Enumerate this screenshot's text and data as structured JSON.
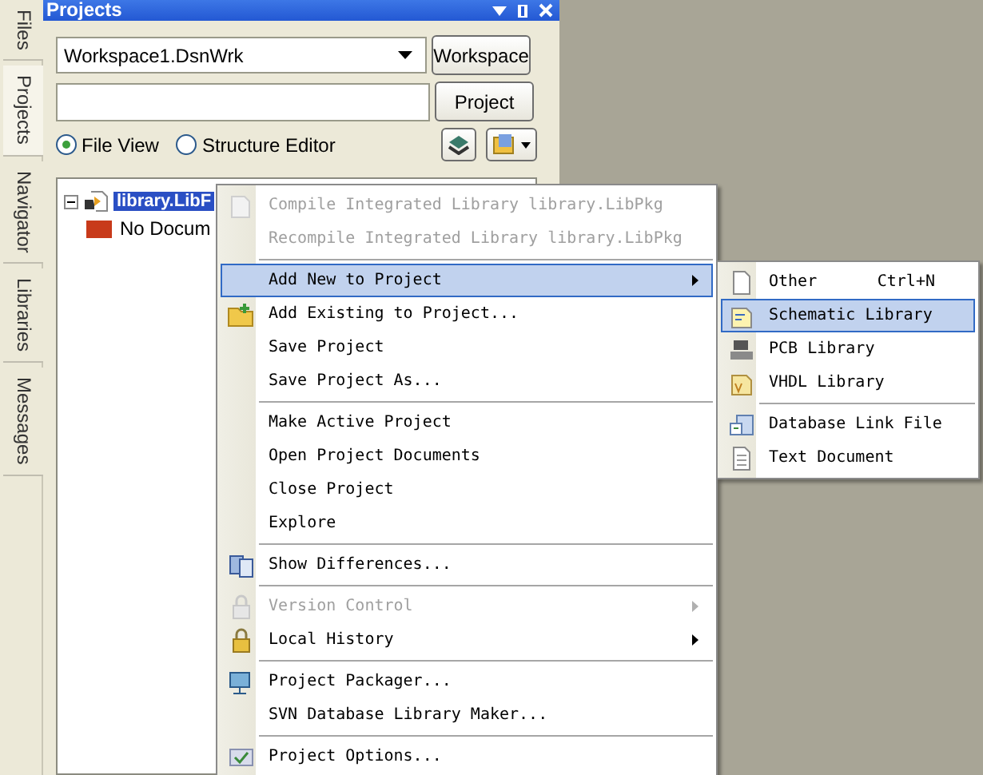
{
  "side_tabs": [
    {
      "label": "Files",
      "selected": false
    },
    {
      "label": "Projects",
      "selected": true
    },
    {
      "label": "Navigator",
      "selected": false
    },
    {
      "label": "Libraries",
      "selected": false
    },
    {
      "label": "Messages",
      "selected": false
    }
  ],
  "panel": {
    "title": "Projects",
    "workspace_combo": {
      "value": "Workspace1.DsnWrk"
    },
    "workspace_button": "Workspace",
    "project_button": "Project",
    "view_options": [
      {
        "label": "File View",
        "selected": true
      },
      {
        "label": "Structure Editor",
        "selected": false
      }
    ],
    "tree": [
      {
        "label": "library.LibF",
        "selected": true,
        "expanded": true,
        "children": [
          {
            "label": "No Docum",
            "selected": false
          }
        ]
      }
    ]
  },
  "context_menu": [
    {
      "kind": "item",
      "label": "Compile Integrated Library library.LibPkg",
      "disabled": true,
      "selected": false,
      "submenu": false
    },
    {
      "kind": "item",
      "label": "Recompile Integrated Library library.LibPkg",
      "disabled": true,
      "selected": false,
      "submenu": false
    },
    {
      "kind": "separator"
    },
    {
      "kind": "item",
      "label": "Add New to Project",
      "disabled": false,
      "selected": true,
      "submenu": true
    },
    {
      "kind": "item",
      "label": "Add Existing to Project...",
      "disabled": false,
      "selected": false,
      "submenu": false
    },
    {
      "kind": "item",
      "label": "Save Project",
      "disabled": false,
      "selected": false,
      "submenu": false
    },
    {
      "kind": "item",
      "label": "Save Project As...",
      "disabled": false,
      "selected": false,
      "submenu": false
    },
    {
      "kind": "separator"
    },
    {
      "kind": "item",
      "label": "Make Active Project",
      "disabled": false,
      "selected": false,
      "submenu": false
    },
    {
      "kind": "item",
      "label": "Open Project Documents",
      "disabled": false,
      "selected": false,
      "submenu": false
    },
    {
      "kind": "item",
      "label": "Close Project",
      "disabled": false,
      "selected": false,
      "submenu": false
    },
    {
      "kind": "item",
      "label": "Explore",
      "disabled": false,
      "selected": false,
      "submenu": false
    },
    {
      "kind": "separator"
    },
    {
      "kind": "item",
      "label": "Show Differences...",
      "disabled": false,
      "selected": false,
      "submenu": false
    },
    {
      "kind": "separator"
    },
    {
      "kind": "item",
      "label": "Version Control",
      "disabled": true,
      "selected": false,
      "submenu": true
    },
    {
      "kind": "item",
      "label": "Local History",
      "disabled": false,
      "selected": false,
      "submenu": true
    },
    {
      "kind": "separator"
    },
    {
      "kind": "item",
      "label": "Project Packager...",
      "disabled": false,
      "selected": false,
      "submenu": false
    },
    {
      "kind": "item",
      "label": "SVN Database Library Maker...",
      "disabled": false,
      "selected": false,
      "submenu": false
    },
    {
      "kind": "separator"
    },
    {
      "kind": "item",
      "label": "Project Options...",
      "disabled": false,
      "selected": false,
      "submenu": false
    }
  ],
  "submenu": [
    {
      "kind": "item",
      "label": "Other",
      "shortcut": "Ctrl+N",
      "selected": false
    },
    {
      "kind": "item",
      "label": "Schematic Library",
      "selected": true
    },
    {
      "kind": "item",
      "label": "PCB Library",
      "selected": false
    },
    {
      "kind": "item",
      "label": "VHDL Library",
      "selected": false
    },
    {
      "kind": "separator"
    },
    {
      "kind": "item",
      "label": "Database Link File",
      "selected": false
    },
    {
      "kind": "item",
      "label": "Text Document",
      "selected": false
    }
  ]
}
